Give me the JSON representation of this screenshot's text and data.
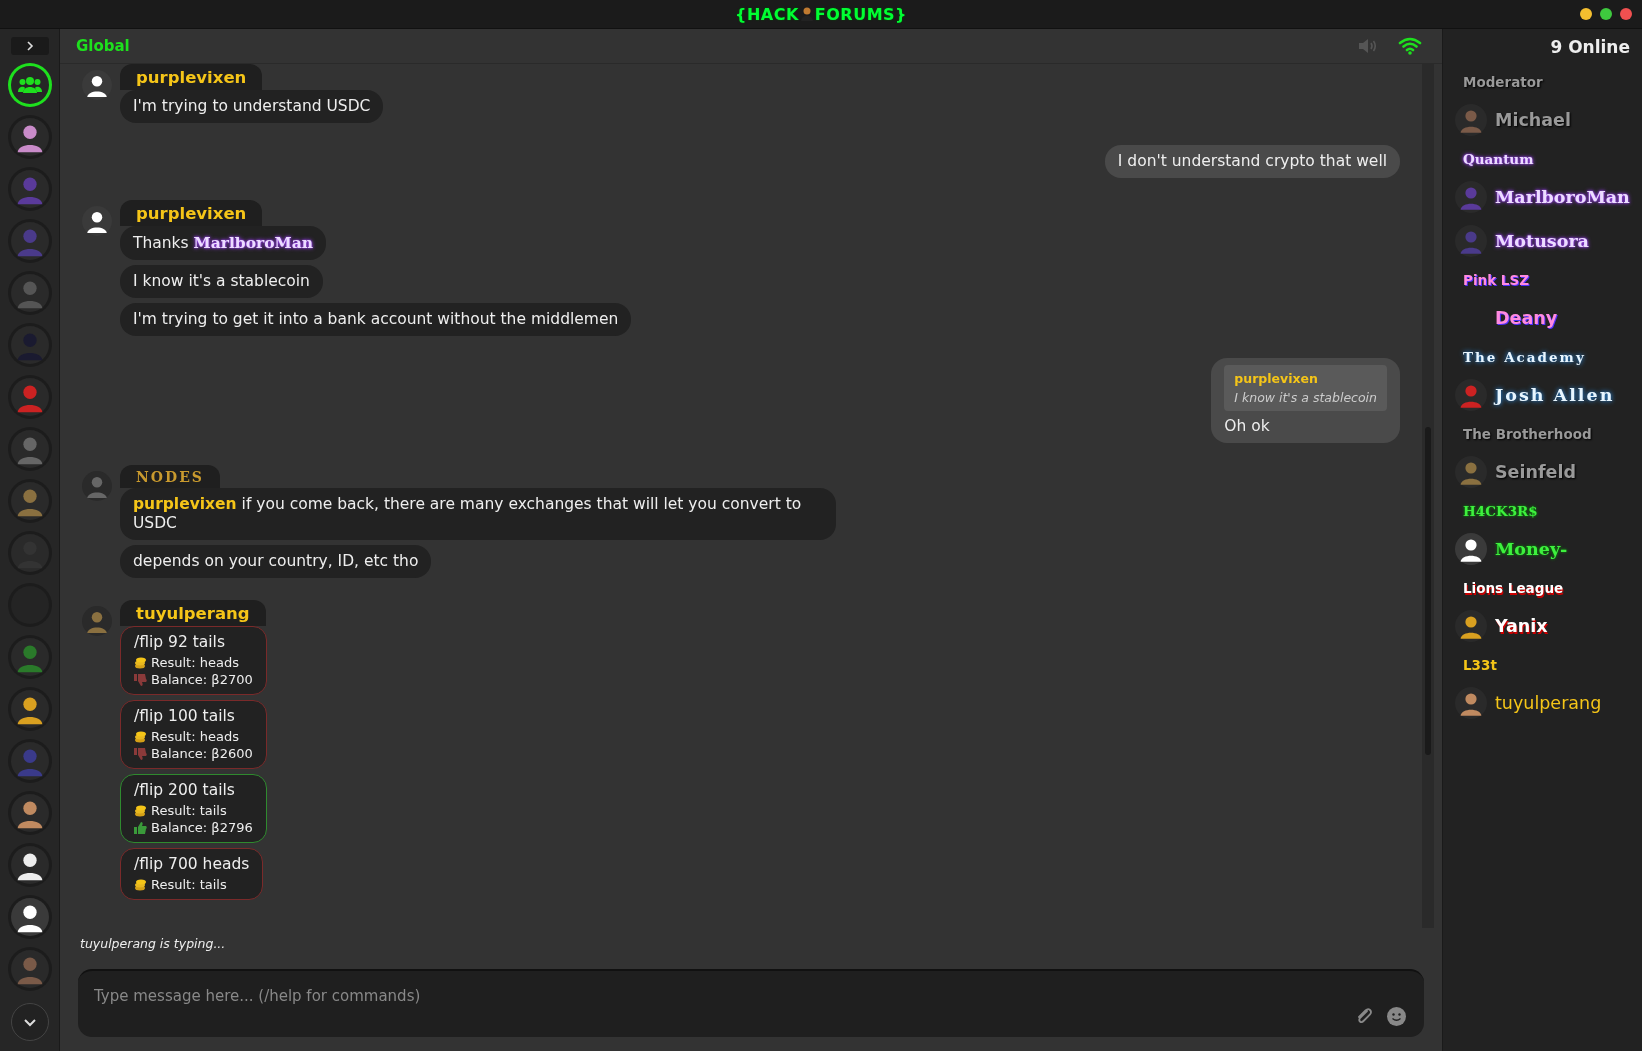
{
  "logo": {
    "left": "{HACK",
    "right": "FORUMS}"
  },
  "rail": [
    {
      "kind": "group",
      "selected": true
    },
    {
      "kind": "picture",
      "selected": false
    },
    {
      "kind": "picture",
      "selected": false
    },
    {
      "kind": "picture",
      "selected": false
    },
    {
      "kind": "picture",
      "selected": false
    },
    {
      "kind": "picture",
      "selected": false
    },
    {
      "kind": "picture",
      "selected": false
    },
    {
      "kind": "picture",
      "selected": false
    },
    {
      "kind": "picture",
      "selected": false
    },
    {
      "kind": "picture",
      "selected": false
    },
    {
      "kind": "blank",
      "selected": false
    },
    {
      "kind": "picture",
      "selected": false
    },
    {
      "kind": "picture",
      "selected": false
    },
    {
      "kind": "picture",
      "selected": false
    },
    {
      "kind": "picture",
      "selected": false
    },
    {
      "kind": "picture",
      "selected": false
    },
    {
      "kind": "silhouette",
      "selected": false
    },
    {
      "kind": "picture",
      "selected": false
    }
  ],
  "channel": {
    "title": "Global"
  },
  "groups": [
    {
      "kind": "received",
      "author": {
        "kind": "gold",
        "name": "purplevixen"
      },
      "avatar": {
        "kind": "silhouette"
      },
      "messages": [
        {
          "kind": "text",
          "text": "I'm trying to understand USDC"
        }
      ]
    },
    {
      "kind": "sent",
      "messages": [
        {
          "kind": "text",
          "text": "I don't understand crypto that well"
        }
      ]
    },
    {
      "kind": "received",
      "author": {
        "kind": "gold",
        "name": "purplevixen"
      },
      "avatar": {
        "kind": "silhouette"
      },
      "messages": [
        {
          "kind": "parts",
          "parts": [
            {
              "kind": "text",
              "text": "Thanks "
            },
            {
              "kind": "gothic",
              "text": "MarlboroMan"
            }
          ]
        },
        {
          "kind": "text",
          "text": "I know it's a stablecoin"
        },
        {
          "kind": "text",
          "text": "I'm trying to get it into a bank account without the middlemen"
        }
      ]
    },
    {
      "kind": "sent",
      "messages": [
        {
          "kind": "reply",
          "quote_author": "purplevixen",
          "quote_text": "I know it's a stablecoin",
          "text": "Oh ok"
        }
      ]
    },
    {
      "kind": "received",
      "author": {
        "kind": "serif",
        "name": "NODES"
      },
      "avatar": {
        "kind": "picture"
      },
      "messages": [
        {
          "kind": "parts",
          "parts": [
            {
              "kind": "gold",
              "text": "purplevixen"
            },
            {
              "kind": "text",
              "text": " if you come back, there are many exchanges that will let you convert to USDC"
            }
          ]
        },
        {
          "kind": "text",
          "text": "depends on your country, ID, etc tho"
        }
      ]
    },
    {
      "kind": "received",
      "author": {
        "kind": "gold",
        "name": "tuyulperang"
      },
      "avatar": {
        "kind": "picture"
      },
      "messages": [
        {
          "kind": "flip",
          "command": "/flip 92 tails",
          "result": "Result: heads",
          "balance": "Balance: β2700",
          "won": false
        },
        {
          "kind": "flip",
          "command": "/flip 100 tails",
          "result": "Result: heads",
          "balance": "Balance: β2600",
          "won": false
        },
        {
          "kind": "flip",
          "command": "/flip 200 tails",
          "result": "Result: tails",
          "balance": "Balance: β2796",
          "won": true
        },
        {
          "kind": "flip",
          "command": "/flip 700 heads",
          "result": "Result: tails",
          "won": false
        }
      ]
    }
  ],
  "typing": "tuyulperang is typing...",
  "composer": {
    "placeholder": "Type message here... (/help for commands)"
  },
  "online": {
    "title": "9 Online",
    "groups": [
      {
        "kind": "grey",
        "label": "Moderator",
        "users": [
          {
            "name": "Michael",
            "avatar": {
              "kind": "picture"
            }
          }
        ]
      },
      {
        "kind": "gothic",
        "label": "Quantum",
        "users": [
          {
            "name": "MarlboroMan",
            "avatar": {
              "kind": "picture"
            }
          },
          {
            "name": "Motusora",
            "avatar": {
              "kind": "picture"
            }
          }
        ]
      },
      {
        "kind": "pink",
        "label": "Pink LSZ",
        "users": [
          {
            "name": "Deany"
          }
        ]
      },
      {
        "kind": "academy",
        "label": "The Academy",
        "users": [
          {
            "name": "Josh Allen",
            "avatar": {
              "kind": "picture"
            }
          }
        ]
      },
      {
        "kind": "grey",
        "label": "The Brotherhood",
        "users": [
          {
            "name": "Seinfeld",
            "avatar": {
              "kind": "picture"
            }
          }
        ]
      },
      {
        "kind": "hacker",
        "label": "H4CK3R$",
        "users": [
          {
            "name": "Money-",
            "avatar": {
              "kind": "silhouette"
            }
          }
        ]
      },
      {
        "kind": "lions",
        "label": "Lions League",
        "users": [
          {
            "name": "Yanix",
            "avatar": {
              "kind": "picture"
            }
          }
        ]
      },
      {
        "kind": "leet",
        "label": "L33t",
        "users": [
          {
            "name": "tuyulperang",
            "avatar": {
              "kind": "picture"
            }
          }
        ]
      }
    ]
  }
}
